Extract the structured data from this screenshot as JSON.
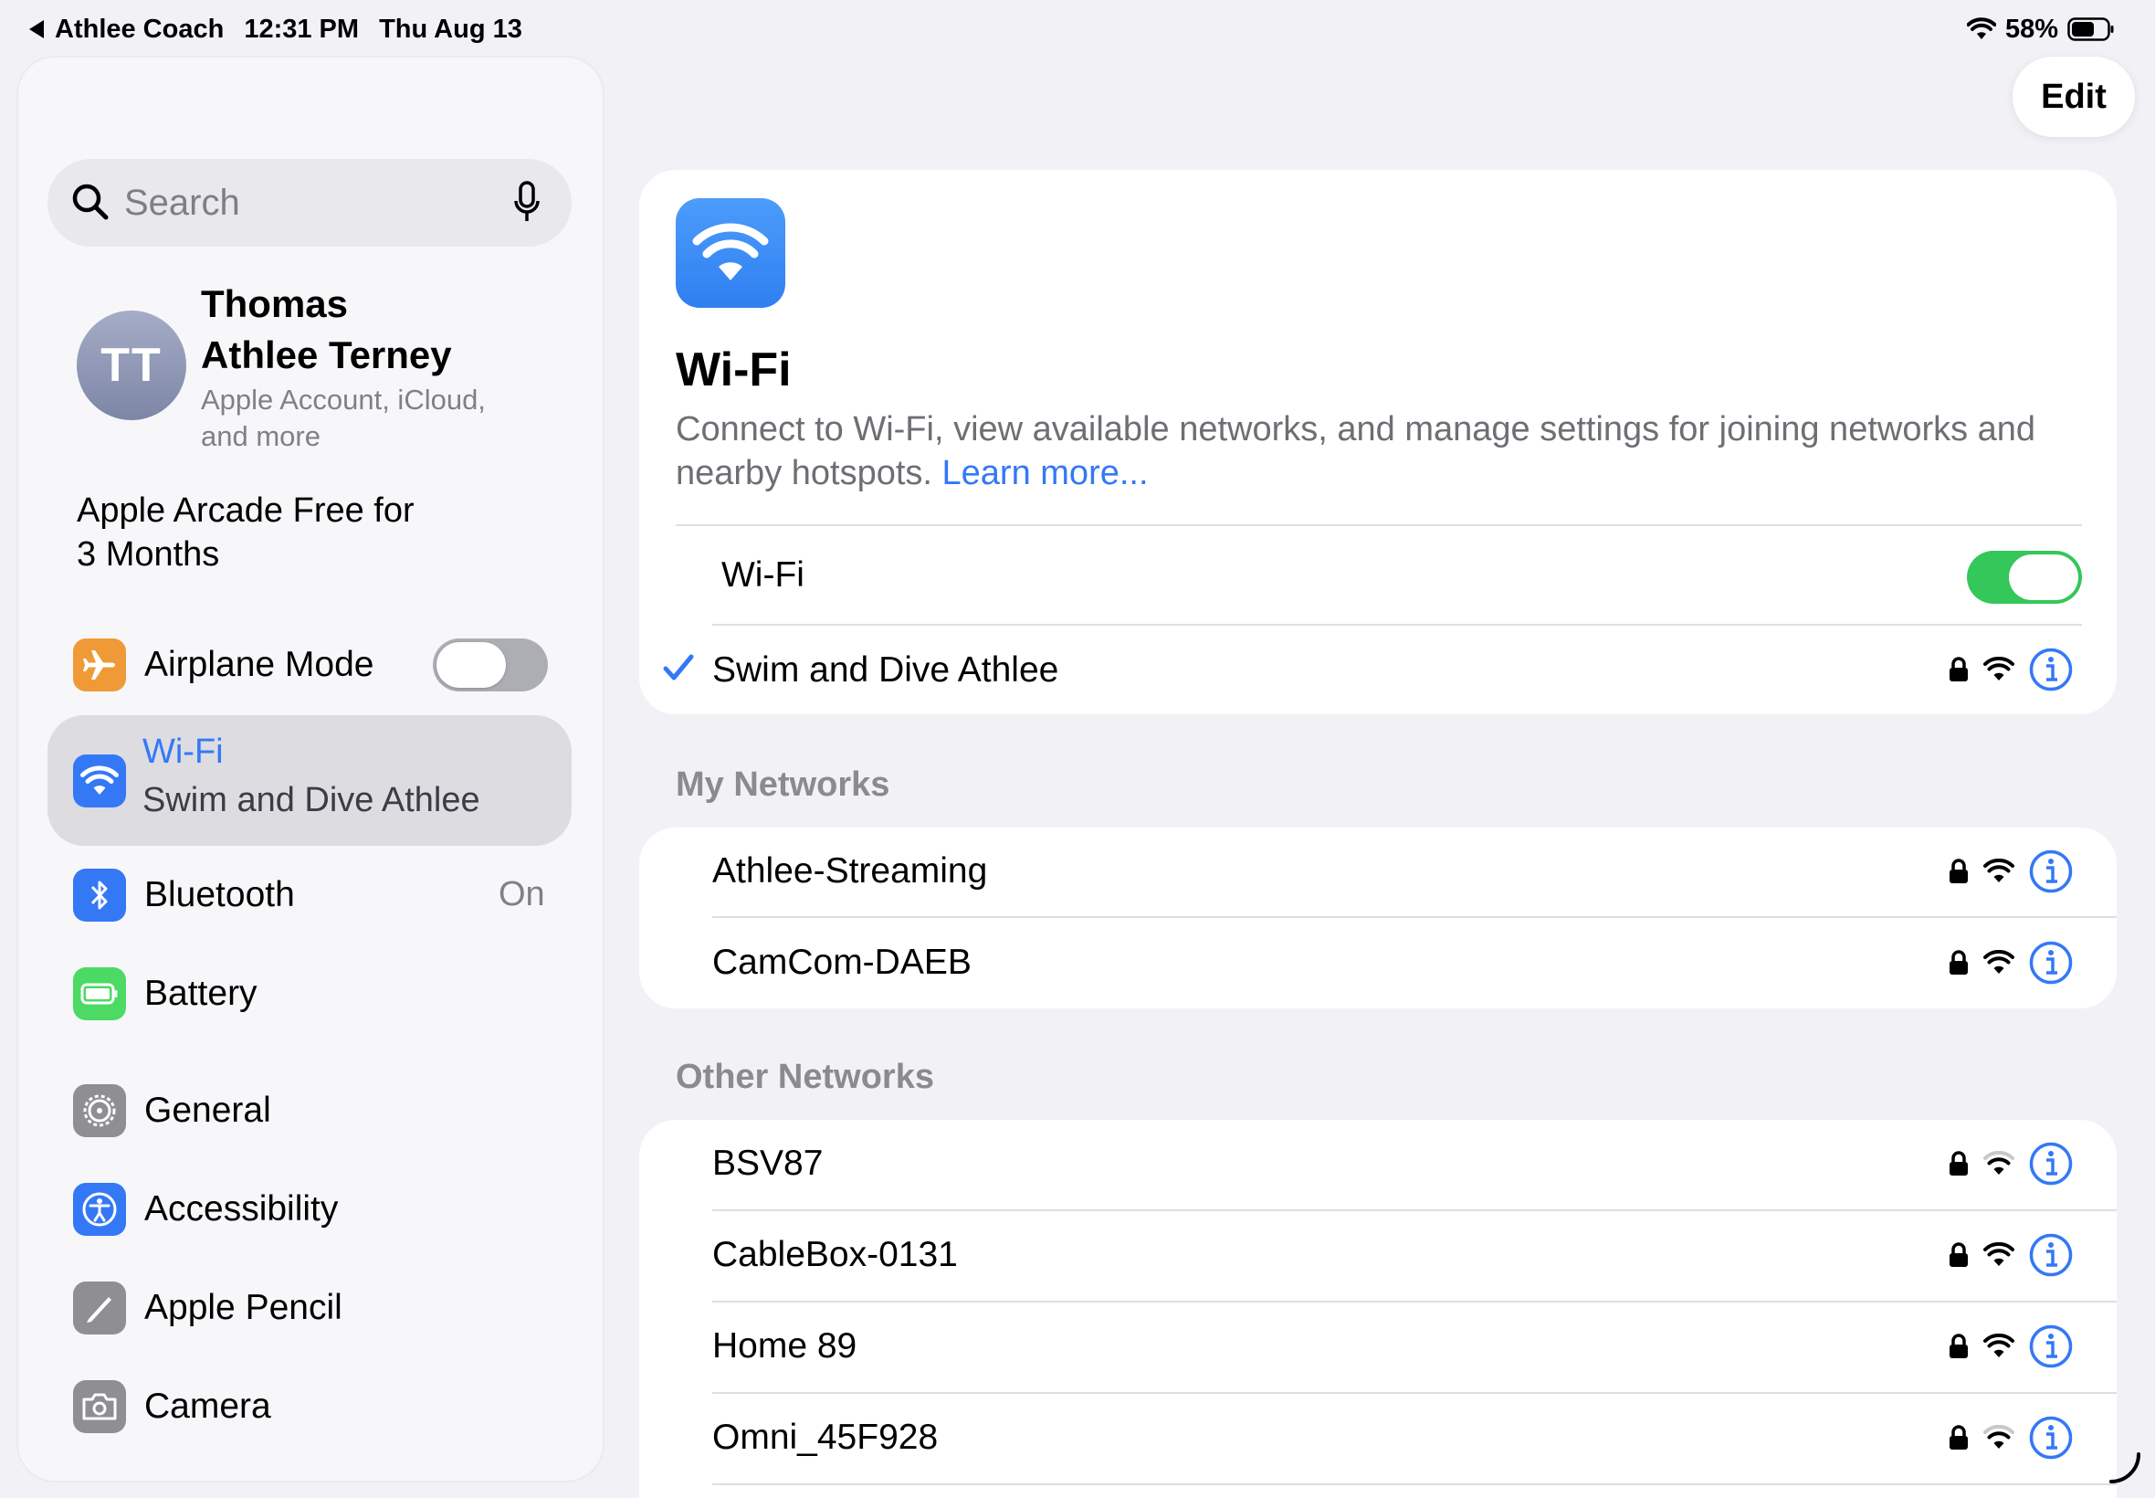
{
  "status_bar": {
    "back_app": "Athlee Coach",
    "time": "12:31 PM",
    "date": "Thu Aug 13",
    "battery_percent": "58%"
  },
  "sidebar": {
    "search_placeholder": "Search",
    "profile": {
      "initials": "TT",
      "name_line1": "Thomas",
      "name_line2": "Athlee Terney",
      "subtitle_line1": "Apple Account, iCloud,",
      "subtitle_line2": "and more"
    },
    "promo_line1": "Apple Arcade Free for",
    "promo_line2": "3 Months",
    "items": [
      {
        "label": "Airplane Mode",
        "icon": "airplane-icon",
        "color": "#f09a37"
      },
      {
        "label": "Wi-Fi",
        "value": "Swim and Dive Athlee",
        "icon": "wifi-icon",
        "color": "#3478f6"
      },
      {
        "label": "Bluetooth",
        "value": "On",
        "icon": "bluetooth-icon",
        "color": "#3478f6"
      },
      {
        "label": "Battery",
        "icon": "battery-icon",
        "color": "#4cd964"
      },
      {
        "label": "General",
        "icon": "gear-icon",
        "color": "#8e8e93"
      },
      {
        "label": "Accessibility",
        "icon": "accessibility-icon",
        "color": "#3478f6"
      },
      {
        "label": "Apple Pencil",
        "icon": "pencil-icon",
        "color": "#8e8e93"
      },
      {
        "label": "Camera",
        "icon": "camera-icon",
        "color": "#8e8e93"
      }
    ]
  },
  "main": {
    "edit_label": "Edit",
    "title": "Wi-Fi",
    "description": "Connect to Wi-Fi, view available networks, and manage settings for joining networks and nearby hotspots.",
    "learn_more": "Learn more...",
    "wifi_toggle_label": "Wi-Fi",
    "connected_network": "Swim and Dive Athlee",
    "my_networks_header": "My Networks",
    "my_networks": [
      "Athlee-Streaming",
      "CamCom-DAEB"
    ],
    "other_networks_header": "Other Networks",
    "other_networks": [
      "BSV87",
      "CableBox-0131",
      "Home 89",
      "Omni_45F928"
    ]
  },
  "colors": {
    "accent": "#3478f6",
    "toggle_on": "#34c759"
  }
}
